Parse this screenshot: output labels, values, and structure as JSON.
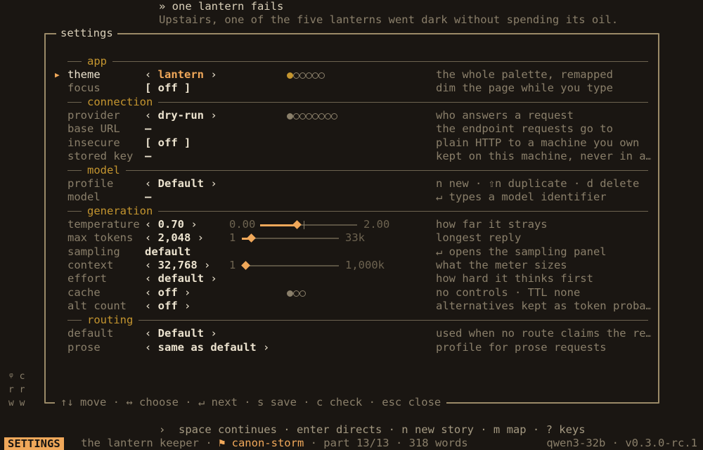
{
  "background": {
    "story_title": "» one lantern fails",
    "story_line": "Upstairs, one of the five lanterns went dark without spending its oil."
  },
  "modal": {
    "title": "settings",
    "hints": "↑↓ move · ↔ choose · ↵ next · s save · c check · esc close"
  },
  "sections": {
    "app": "app",
    "connection": "connection",
    "model": "model",
    "generation": "generation",
    "routing": "routing"
  },
  "rows": {
    "theme": {
      "key": "theme",
      "value": "lantern",
      "desc": "the whole palette, remapped",
      "dots_total": 6,
      "dots_index": 1
    },
    "focus": {
      "key": "focus",
      "value": "[ off ]",
      "desc": "dim the page while you type"
    },
    "provider": {
      "key": "provider",
      "value": "dry-run",
      "desc": "who answers a request",
      "dots_total": 8,
      "dots_index": 1
    },
    "base_url": {
      "key": "base URL",
      "value": "—",
      "desc": "the endpoint requests go to"
    },
    "insecure": {
      "key": "insecure",
      "value": "[ off ]",
      "desc": "plain HTTP to a machine you own"
    },
    "stored_key": {
      "key": "stored key",
      "value": "—",
      "desc": "kept on this machine, never in a…"
    },
    "profile": {
      "key": "profile",
      "value": "Default",
      "desc": "n new · ⇧n duplicate · d delete"
    },
    "model": {
      "key": "model",
      "value": "—",
      "desc": "↵ types a model identifier"
    },
    "temperature": {
      "key": "temperature",
      "value": "0.70",
      "desc": "how far it strays",
      "min": "0.00",
      "max": "2.00"
    },
    "max_tokens": {
      "key": "max tokens",
      "value": "2,048",
      "desc": "longest reply",
      "min": "1",
      "max": "33k"
    },
    "sampling": {
      "key": "sampling",
      "value": "default",
      "desc": "↵ opens the sampling panel"
    },
    "context": {
      "key": "context",
      "value": "32,768",
      "desc": "what the meter sizes",
      "min": "1",
      "max": "1,000k"
    },
    "effort": {
      "key": "effort",
      "value": "default",
      "desc": "how hard it thinks first"
    },
    "cache": {
      "key": "cache",
      "value": "off",
      "desc": "no controls · TTL none",
      "dots_total": 3,
      "dots_index": 1
    },
    "alt_count": {
      "key": "alt count",
      "value": "off",
      "desc": "alternatives kept as token proba…"
    },
    "default": {
      "key": "default",
      "value": "Default",
      "desc": "used when no route claims the re…"
    },
    "prose": {
      "key": "prose",
      "value": "same as default",
      "desc": "profile for prose requests"
    }
  },
  "left_gutter": "ᵠ c\nr r\nw w",
  "bottom_hints": "›  space continues · enter directs · n new story · m map · ? keys",
  "status": {
    "mode": "SETTINGS",
    "app": "the lantern keeper",
    "sep1": " · ",
    "story": "⚑ canon-storm",
    "rest": " · part 13/13 · 318 words",
    "right": "qwen3-32b · v0.3.0-rc.1"
  },
  "colors": {
    "background": "#1a1612",
    "accent": "#f0a85a",
    "section": "#c4952f",
    "text": "#ece3cf",
    "muted": "#8a7f6a"
  }
}
